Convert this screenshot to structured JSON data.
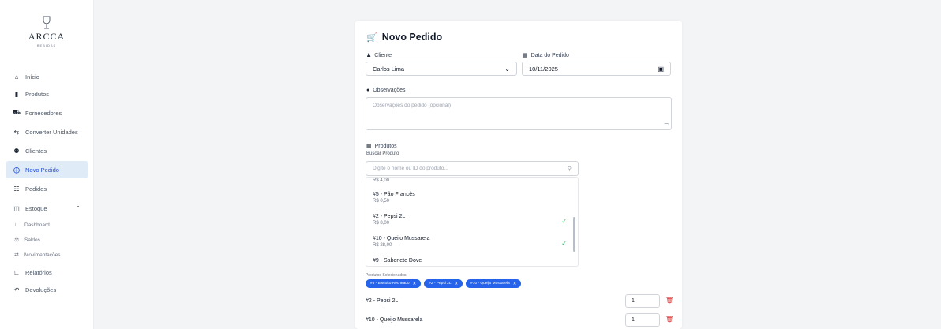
{
  "brand": {
    "name": "ARCCA",
    "tagline": "BEBIDAS"
  },
  "nav": [
    {
      "label": "Início",
      "icon": "home-icon"
    },
    {
      "label": "Produtos",
      "icon": "box-icon"
    },
    {
      "label": "Fornecedores",
      "icon": "truck-icon"
    },
    {
      "label": "Converter Unidades",
      "icon": "swap-icon"
    },
    {
      "label": "Clientes",
      "icon": "users-icon"
    },
    {
      "label": "Novo Pedido",
      "icon": "plus-circle-icon"
    },
    {
      "label": "Pedidos",
      "icon": "cart-icon"
    },
    {
      "label": "Estoque",
      "icon": "warehouse-icon"
    },
    {
      "label": "Relatórios",
      "icon": "chart-icon"
    },
    {
      "label": "Devoluções",
      "icon": "undo-icon"
    }
  ],
  "estoque_sub": [
    {
      "label": "Dashboard",
      "icon": "dashboard-icon"
    },
    {
      "label": "Saldos",
      "icon": "balance-icon"
    },
    {
      "label": "Movimentações",
      "icon": "transfer-icon"
    }
  ],
  "form": {
    "title": "Novo Pedido",
    "cliente_label": "Cliente",
    "cliente_value": "Carlos Lima",
    "data_label": "Data do Pedido",
    "data_value": "10/11/2025",
    "obs_label": "Observações",
    "obs_placeholder": "Observações do pedido (opcional)",
    "produtos_label": "Produtos",
    "buscar_label": "Buscar Produto",
    "buscar_placeholder": "Digite o nome ou ID do produto...",
    "selecionados_label": "Produtos Selecionados:"
  },
  "dropdown": {
    "partial_price": "R$ 4,00",
    "options": [
      {
        "name": "#5 - Pão Francês",
        "price": "R$ 0,50",
        "checked": false
      },
      {
        "name": "#2 - Pepsi 2L",
        "price": "R$ 8,00",
        "checked": true
      },
      {
        "name": "#10 - Queijo Mussarela",
        "price": "R$ 28,00",
        "checked": true
      },
      {
        "name": "#9 - Sabonete Dove",
        "price": "",
        "checked": false
      }
    ]
  },
  "chips": [
    "#8 - Biscoito Recheado",
    "#2 - Pepsi 2L",
    "#10 - Queijo Mussarela"
  ],
  "items": [
    {
      "name": "#2 - Pepsi 2L",
      "qty": "1"
    },
    {
      "name": "#10 - Queijo Mussarela",
      "qty": "1"
    }
  ],
  "colors": {
    "accent": "#2563eb",
    "active_bg": "#e0ebf8",
    "danger": "#dc2626",
    "success": "#22c55e"
  }
}
